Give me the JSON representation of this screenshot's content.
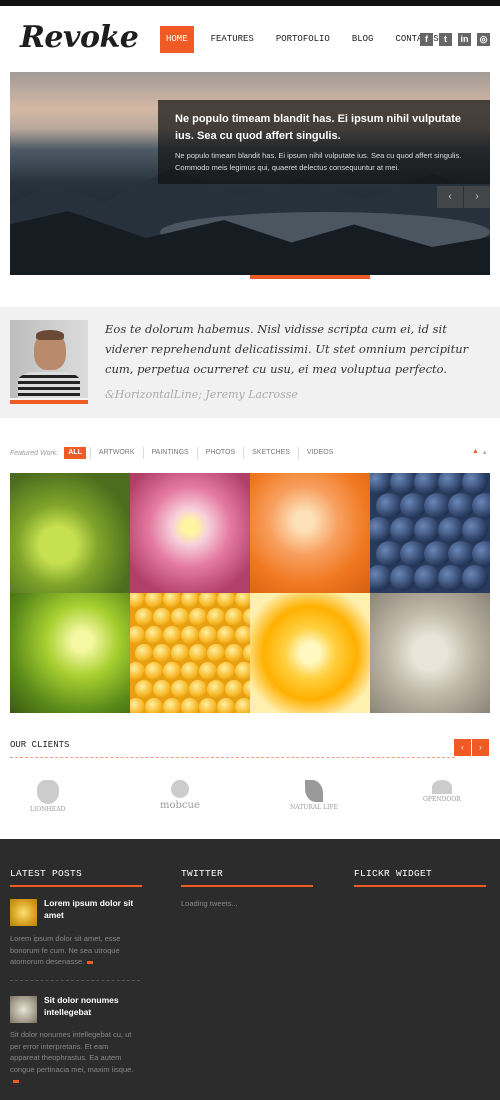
{
  "header": {
    "logo": "Revoke",
    "nav": [
      "HOME",
      "FEATURES",
      "PORTOFOLIO",
      "BLOG",
      "CONTACTS"
    ],
    "social_icons": [
      "facebook-icon",
      "twitter-icon",
      "linkedin-icon",
      "dribbble-icon"
    ]
  },
  "slider": {
    "caption_title": "Ne populo timeam blandit has. Ei ipsum nihil vulputate ius. Sea cu quod affert singulis.",
    "caption_text": "Ne populo timeam blandit has. Ei ipsum nihil vulputate ius. Sea cu quod affert singulis. Commodo meis legimus qui, quaeret delectus consequuntur at mei.",
    "prev": "‹",
    "next": "›"
  },
  "testimonial": {
    "quote": "Eos te dolorum habemus. Nisl vidisse scripta cum ei, id sit viderer reprehendunt delicatissimi. Ut stet omnium percipitur cum, perpetua ocurreret cu usu, ei mea voluptua perfecto.",
    "author": "&HorizontalLine; Jeremy Lacrosse"
  },
  "portfolio": {
    "label": "Featured Work:",
    "filters": [
      "ALL",
      "ARTWORK",
      "PAINTINGS",
      "PHOTOS",
      "SKETCHES",
      "VIDEOS"
    ]
  },
  "clients": {
    "title": "OUR CLIENTS",
    "logos": [
      "LIONHEAD",
      "mobcue",
      "NATURAL LIFE",
      "OPENDOOR"
    ]
  },
  "footer": {
    "latest_title": "LATEST POSTS",
    "twitter_title": "TWITTER",
    "flickr_title": "FLICKR WIDGET",
    "twitter_text": "Loading tweets...",
    "posts": [
      {
        "title": "Lorem ipsum dolor sit amet",
        "text": "Lorem ipsum dolor sit amet, esse bonorum fe cum. Ne sea utroque atomorum desenasse."
      },
      {
        "title": "Sit dolor nonumes intellegebat",
        "text": "Sit dolor nonumes intellegebat cu, ut per error interpretaris. Et eam appareat theophrastus. Ea autem congue pertinacia mei, maxim iisque."
      }
    ]
  },
  "colors": {
    "accent": "#f05a24",
    "footer_bg": "#2c2c2c",
    "quote_bg": "#f1f1f1"
  }
}
